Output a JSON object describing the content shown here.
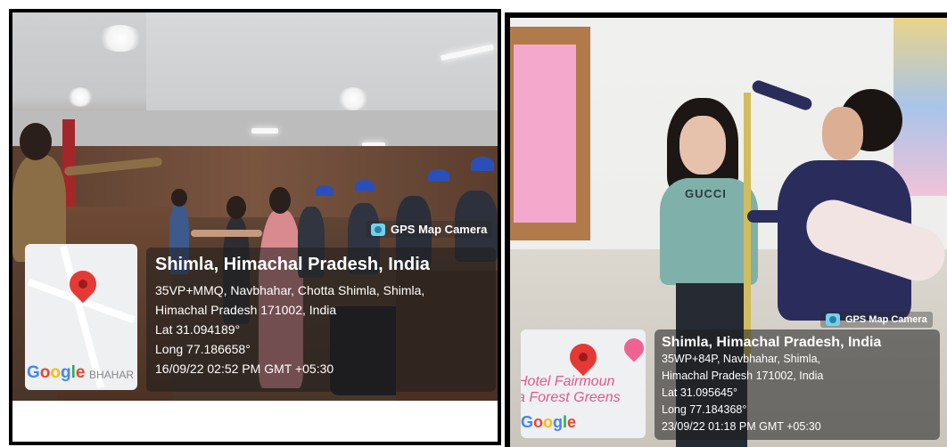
{
  "photos": [
    {
      "gps_label": "GPS Map Camera",
      "map_text": "BHAHAR",
      "google": "Google",
      "title": "Shimla, Himachal Pradesh, India",
      "address_line1": "35VP+MMQ, Navbhahar, Chotta Shimla, Shimla,",
      "address_line2": "Himachal Pradesh 171002, India",
      "lat": "Lat 31.094189°",
      "long": "Long 77.186658°",
      "datetime": "16/09/22 02:52 PM GMT +05:30"
    },
    {
      "gps_label": "GPS Map Camera",
      "map_text1": "Hotel Fairmoun",
      "map_text2": "a Forest Greens",
      "shirt_text": "GUCCI",
      "google": "Google",
      "title": "Shimla, Himachal Pradesh, India",
      "address_line1": "35WP+84P, Navbhahar, Shimla,",
      "address_line2": "Himachal Pradesh 171002, India",
      "lat": "Lat 31.095645°",
      "long": "Long 77.184368°",
      "datetime": "23/09/22 01:18 PM GMT +05:30"
    }
  ],
  "colors": {
    "pin": "#e53935",
    "cap_blue": "#2b4fb8",
    "info_bg": "rgba(30,30,30,0.55)"
  }
}
